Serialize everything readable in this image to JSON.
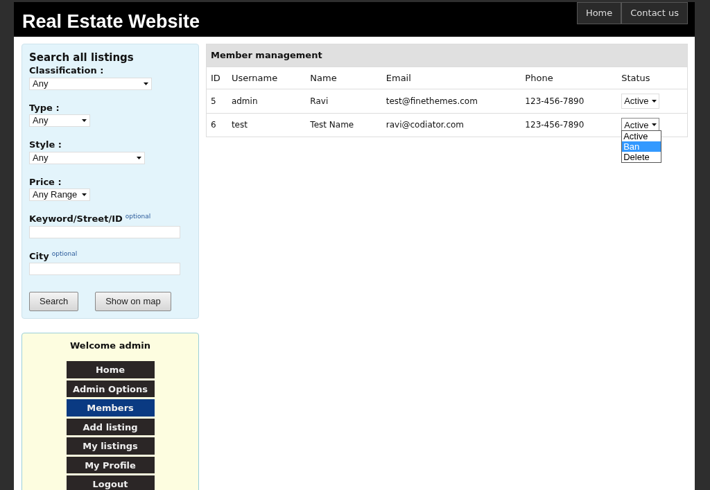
{
  "header": {
    "title": "Real Estate Website",
    "nav": [
      {
        "label": "Home"
      },
      {
        "label": "Contact us"
      }
    ]
  },
  "search": {
    "title": "Search all listings",
    "fields": [
      {
        "kind": "select",
        "label": "Classification :",
        "value": "Any"
      },
      {
        "kind": "select",
        "label": "Type :",
        "value": "Any"
      },
      {
        "kind": "select",
        "label": "Style :",
        "value": "Any"
      },
      {
        "kind": "select",
        "label": "Price :",
        "value": "Any Range"
      },
      {
        "kind": "text",
        "label": "Keyword/Street/ID",
        "hint": "optional"
      },
      {
        "kind": "text",
        "label": "City",
        "hint": "optional"
      }
    ],
    "buttons": [
      "Search",
      "Show on map"
    ]
  },
  "user_menu": {
    "title": "Welcome admin",
    "items": [
      {
        "label": "Home",
        "selected": false
      },
      {
        "label": "Admin Options",
        "selected": false
      },
      {
        "label": "Members",
        "selected": true
      },
      {
        "label": "Add listing",
        "selected": false
      },
      {
        "label": "My listings",
        "selected": false
      },
      {
        "label": "My Profile",
        "selected": false
      },
      {
        "label": "Logout",
        "selected": false
      }
    ]
  },
  "members": {
    "title": "Member management",
    "columns": [
      "ID",
      "Username",
      "Name",
      "Email",
      "Phone",
      "Status"
    ],
    "rows": [
      {
        "id": "5",
        "username": "admin",
        "name": "Ravi",
        "email": "test@finethemes.com",
        "phone": "123-456-7890",
        "status": "Active",
        "expanded": false
      },
      {
        "id": "6",
        "username": "test",
        "name": "Test Name",
        "email": "ravi@codiator.com",
        "phone": "123-456-7890",
        "status": "Active",
        "expanded": true,
        "options": [
          {
            "label": "Active",
            "selected": false
          },
          {
            "label": "Ban",
            "selected": true
          },
          {
            "label": "Delete",
            "selected": false
          }
        ]
      }
    ]
  }
}
